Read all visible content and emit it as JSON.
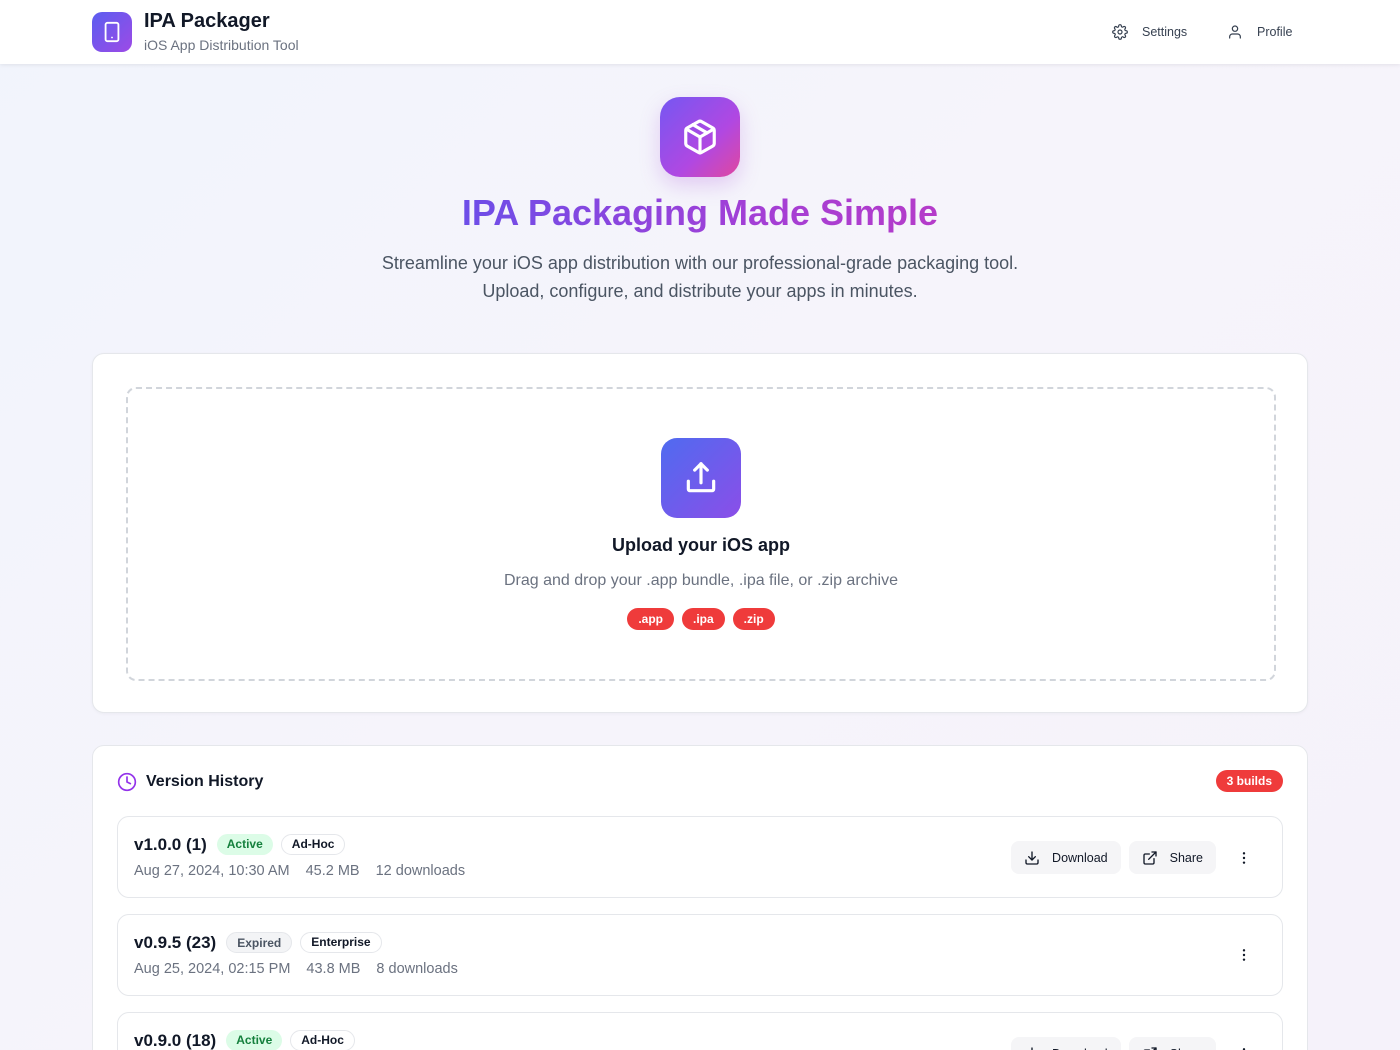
{
  "header": {
    "title": "IPA Packager",
    "subtitle": "iOS App Distribution Tool",
    "nav": {
      "settings": "Settings",
      "profile": "Profile"
    }
  },
  "hero": {
    "title": "IPA Packaging Made Simple",
    "description": "Streamline your iOS app distribution with our professional-grade packaging tool. Upload, configure, and distribute your apps in minutes."
  },
  "upload": {
    "title": "Upload your iOS app",
    "description": "Drag and drop your .app bundle, .ipa file, or .zip archive",
    "formats": [
      ".app",
      ".ipa",
      ".zip"
    ]
  },
  "history": {
    "title": "Version History",
    "count_label": "3 builds",
    "actions": {
      "download": "Download",
      "share": "Share"
    },
    "builds": [
      {
        "version": "v1.0.0 (1)",
        "status": "Active",
        "type": "Ad-Hoc",
        "date": "Aug 27, 2024, 10:30 AM",
        "size": "45.2 MB",
        "downloads": "12 downloads"
      },
      {
        "version": "v0.9.5 (23)",
        "status": "Expired",
        "type": "Enterprise",
        "date": "Aug 25, 2024, 02:15 PM",
        "size": "43.8 MB",
        "downloads": "8 downloads"
      },
      {
        "version": "v0.9.0 (18)",
        "status": "Active",
        "type": "Ad-Hoc",
        "date": "",
        "size": "",
        "downloads": ""
      }
    ]
  },
  "colors": {
    "accent": "#6d4ee8",
    "brand_gradient_start": "#5b5ef0",
    "brand_gradient_end": "#9d4ae6",
    "badge_red": "#ef3b3b",
    "active_green": "#15803d"
  },
  "icons": {
    "logo": "smartphone-icon",
    "settings": "gear-icon",
    "profile": "user-icon",
    "hero": "package-icon",
    "upload": "upload-icon",
    "history": "clock-icon",
    "download": "download-icon",
    "share": "external-link-icon",
    "more": "more-vertical-icon"
  }
}
